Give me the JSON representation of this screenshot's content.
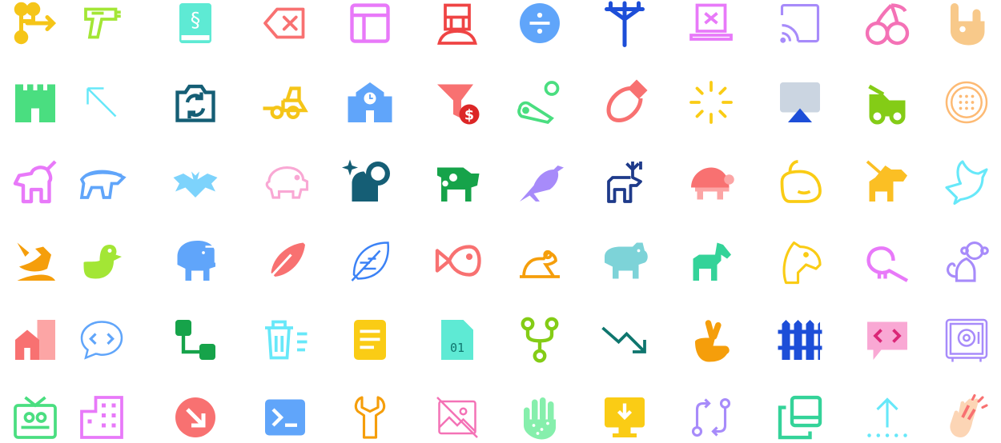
{
  "icon_grid": {
    "rows": [
      [
        {
          "name": "arrows-split-icon",
          "color": "#f5c518"
        },
        {
          "name": "water-gun-icon",
          "color": "#a3e635"
        },
        {
          "name": "law-book-icon",
          "color": "#5eead4"
        },
        {
          "name": "backspace-icon",
          "color": "#f87171"
        },
        {
          "name": "layout-icon",
          "color": "#e879f9"
        },
        {
          "name": "bounty-hunter-helmet-icon",
          "color": "#ef4444"
        },
        {
          "name": "divide-icon",
          "color": "#60a5fa"
        },
        {
          "name": "utility-pole-icon",
          "color": "#1d4ed8"
        },
        {
          "name": "laptop-off-icon",
          "color": "#e879f9"
        },
        {
          "name": "cast-icon",
          "color": "#a78bfa"
        },
        {
          "name": "cherry-icon",
          "color": "#f472b6"
        },
        {
          "name": "hand-rock-icon",
          "color": "#f8c98a"
        }
      ],
      [
        {
          "name": "castle-icon",
          "color": "#4ade80"
        },
        {
          "name": "arrow-up-left-icon",
          "color": "#67e8f9"
        },
        {
          "name": "camera-rotate-icon",
          "color": "#155e75"
        },
        {
          "name": "bulldozer-icon",
          "color": "#f5c518"
        },
        {
          "name": "school-icon",
          "color": "#60a5fa"
        },
        {
          "name": "funnel-dollar-icon",
          "color": "#f87171"
        },
        {
          "name": "pinball-icon",
          "color": "#4ade80"
        },
        {
          "name": "meat-icon",
          "color": "#f87171"
        },
        {
          "name": "sparkle-burst-icon",
          "color": "#facc15"
        },
        {
          "name": "airplay-icon",
          "color": "#1d4ed8"
        },
        {
          "name": "tow-truck-icon",
          "color": "#84cc16"
        },
        {
          "name": "manhole-icon",
          "color": "#fdba74"
        }
      ],
      [
        {
          "name": "unicorn-icon",
          "color": "#e879f9"
        },
        {
          "name": "honey-badger-icon",
          "color": "#60a5fa"
        },
        {
          "name": "bat-icon",
          "color": "#7dd3fc"
        },
        {
          "name": "pig-icon",
          "color": "#f9a8d4"
        },
        {
          "name": "cat-space-icon",
          "color": "#155e75"
        },
        {
          "name": "cow-icon",
          "color": "#16a34a"
        },
        {
          "name": "crow-icon",
          "color": "#a78bfa"
        },
        {
          "name": "deer-icon",
          "color": "#1e3a8a"
        },
        {
          "name": "turtle-icon",
          "color": "#f87171"
        },
        {
          "name": "whale-icon",
          "color": "#facc15"
        },
        {
          "name": "dog-leashed-icon",
          "color": "#fbbf24"
        },
        {
          "name": "dove-icon",
          "color": "#67e8f9"
        }
      ],
      [
        {
          "name": "dragon-icon",
          "color": "#f59e0b"
        },
        {
          "name": "duck-icon",
          "color": "#a3e635"
        },
        {
          "name": "elephant-icon",
          "color": "#60a5fa"
        },
        {
          "name": "feather-icon",
          "color": "#f87171"
        },
        {
          "name": "leaf-icon",
          "color": "#3b82f6"
        },
        {
          "name": "fish-icon",
          "color": "#f87171"
        },
        {
          "name": "frog-icon",
          "color": "#f59e0b"
        },
        {
          "name": "hippo-icon",
          "color": "#7dd3d8"
        },
        {
          "name": "horse-icon",
          "color": "#34d399"
        },
        {
          "name": "horse-head-icon",
          "color": "#facc15"
        },
        {
          "name": "kiwi-bird-icon",
          "color": "#e879f9"
        },
        {
          "name": "monkey-icon",
          "color": "#a78bfa"
        }
      ],
      [
        {
          "name": "city-icon",
          "color": "#f87171"
        },
        {
          "name": "message-code-icon",
          "color": "#60a5fa"
        },
        {
          "name": "diagram-steps-icon",
          "color": "#16a34a"
        },
        {
          "name": "trash-list-icon",
          "color": "#67e8f9"
        },
        {
          "name": "file-lines-icon",
          "color": "#facc15"
        },
        {
          "name": "file-binary-icon",
          "color": "#5eead4"
        },
        {
          "name": "code-fork-icon",
          "color": "#84cc16"
        },
        {
          "name": "arrow-trend-down-icon",
          "color": "#0f766e"
        },
        {
          "name": "hand-fingers-crossed-icon",
          "color": "#f59e0b"
        },
        {
          "name": "fence-icon",
          "color": "#1d4ed8"
        },
        {
          "name": "comment-code-icon",
          "color": "#f9a8d4"
        },
        {
          "name": "safe-icon",
          "color": "#a78bfa"
        }
      ],
      [
        {
          "name": "tv-retro-icon",
          "color": "#4ade80"
        },
        {
          "name": "building-icon",
          "color": "#e879f9"
        },
        {
          "name": "circle-arrow-down-right-icon",
          "color": "#f87171"
        },
        {
          "name": "terminal-icon",
          "color": "#60a5fa"
        },
        {
          "name": "wrench-icon",
          "color": "#f59e0b"
        },
        {
          "name": "image-slash-icon",
          "color": "#f472b6"
        },
        {
          "name": "hand-dots-icon",
          "color": "#86efac"
        },
        {
          "name": "desktop-arrow-down-icon",
          "color": "#facc15"
        },
        {
          "name": "arrows-repeat-icon",
          "color": "#a78bfa"
        },
        {
          "name": "clone-icon",
          "color": "#34d399"
        },
        {
          "name": "arrow-up-from-dotted-line-icon",
          "color": "#67e8f9"
        },
        {
          "name": "hands-clapping-icon",
          "color": "#f87171"
        }
      ]
    ]
  }
}
